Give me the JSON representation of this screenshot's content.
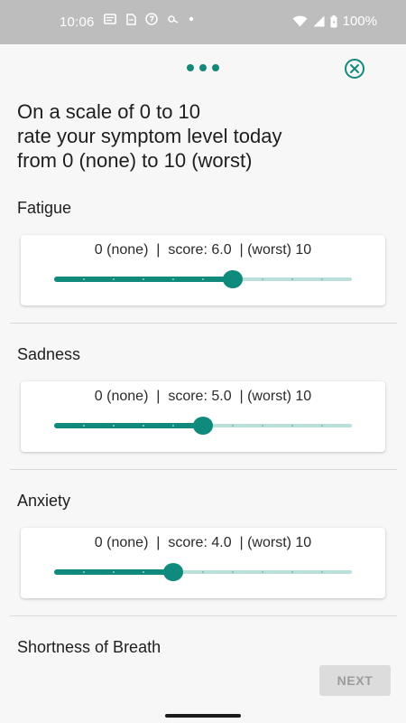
{
  "status_bar": {
    "time": "10:06",
    "notification_icons": [
      "message-icon",
      "sim-icon",
      "seven-badge-icon",
      "key-icon",
      "dot-icon"
    ],
    "battery_percent": "100%"
  },
  "top_bar": {
    "menu_icon": "more-horizontal-icon",
    "close_icon": "close-circle-icon",
    "accent_color": "#14897b"
  },
  "heading": {
    "line1": "On a scale of 0 to 10",
    "line2": "rate your symptom level today",
    "line3": "from 0 (none) to 10 (worst)"
  },
  "symptoms": [
    {
      "name": "Fatigue",
      "scale_text": "0 (none)  |  score: 6.0  | (worst) 10",
      "score": 6.0
    },
    {
      "name": "Sadness",
      "scale_text": "0 (none)  |  score: 5.0  | (worst) 10",
      "score": 5.0
    },
    {
      "name": "Anxiety",
      "scale_text": "0 (none)  |  score: 4.0  | (worst) 10",
      "score": 4.0
    },
    {
      "name": "Shortness of Breath"
    }
  ],
  "slider_range": {
    "min": 0,
    "max": 10
  },
  "footer": {
    "next_label": "NEXT"
  }
}
